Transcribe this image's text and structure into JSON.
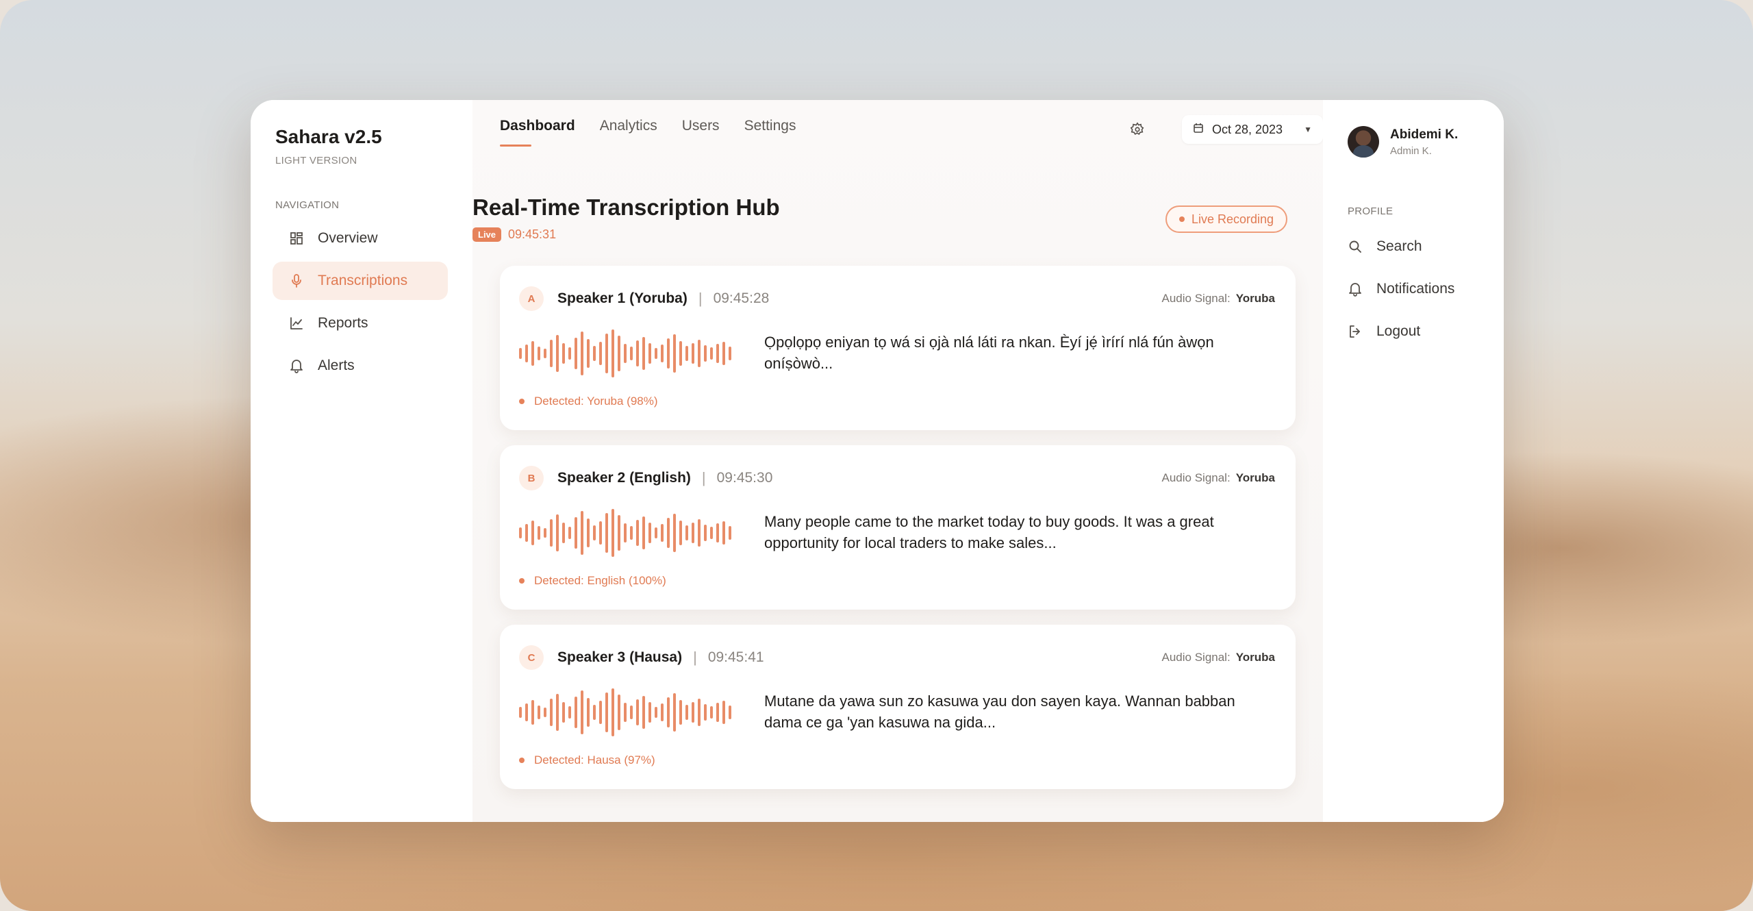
{
  "brand": {
    "title": "Sahara v2.5",
    "subtitle": "LIGHT VERSION"
  },
  "sidebar": {
    "section_label": "NAVIGATION",
    "items": [
      {
        "label": "Overview",
        "icon": "grid-icon",
        "active": false
      },
      {
        "label": "Transcriptions",
        "icon": "microphone-icon",
        "active": true
      },
      {
        "label": "Reports",
        "icon": "line-chart-icon",
        "active": false
      },
      {
        "label": "Alerts",
        "icon": "bell-icon",
        "active": false
      }
    ]
  },
  "header": {
    "tabs": [
      {
        "label": "Dashboard",
        "active": true
      },
      {
        "label": "Analytics",
        "active": false
      },
      {
        "label": "Users",
        "active": false
      },
      {
        "label": "Settings",
        "active": false
      }
    ],
    "date": "Oct 28, 2023"
  },
  "hub": {
    "title": "Real-Time Transcription Hub",
    "live_badge": "Live",
    "live_time": "09:45:31",
    "recording_label": "Live Recording"
  },
  "cards": [
    {
      "letter": "A",
      "speaker": "Speaker 1 (Yoruba)",
      "time": "09:45:28",
      "signal_label": "Audio Signal:",
      "signal_value": "Yoruba",
      "transcript": "Ọpọlọpọ eniyan tọ wá si ọjà nlá láti ra nkan. Èyí jẹ́ ìrírí nlá fún àwọn oníṣòwò...",
      "detected": "Detected: Yoruba (98%)"
    },
    {
      "letter": "B",
      "speaker": "Speaker 2 (English)",
      "time": "09:45:30",
      "signal_label": "Audio Signal:",
      "signal_value": "Yoruba",
      "transcript": "Many people came to the market today to buy goods. It was a great opportunity for local traders to make sales...",
      "detected": "Detected: English (100%)"
    },
    {
      "letter": "C",
      "speaker": "Speaker 3 (Hausa)",
      "time": "09:45:41",
      "signal_label": "Audio Signal:",
      "signal_value": "Yoruba",
      "transcript": "Mutane da yawa sun zo kasuwa yau don sayen kaya. Wannan babban dama ce ga 'yan kasuwa na gida...",
      "detected": "Detected: Hausa (97%)"
    }
  ],
  "user": {
    "name": "Abidemi K.",
    "role": "Admin K."
  },
  "profile": {
    "section_label": "PROFILE",
    "items": [
      {
        "label": "Search",
        "icon": "search-icon"
      },
      {
        "label": "Notifications",
        "icon": "bell-icon"
      },
      {
        "label": "Logout",
        "icon": "logout-icon"
      }
    ]
  },
  "colors": {
    "accent": "#e6825a",
    "accent_soft": "#fbede6",
    "text": "#1f1d1b"
  }
}
